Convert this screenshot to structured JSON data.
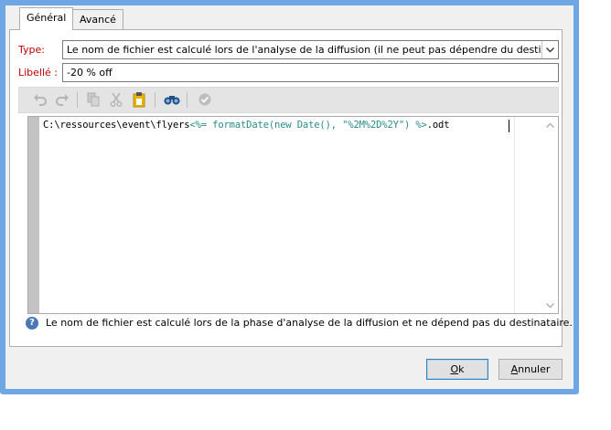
{
  "tabs": [
    {
      "label": "Général",
      "active": true
    },
    {
      "label": "Avancé",
      "active": false
    }
  ],
  "form": {
    "type_label": "Type:",
    "type_value": "Le nom de fichier est calculé lors de l'analyse de la diffusion (il ne peut pas dépendre du destinataire)",
    "libelle_label": "Libellé :",
    "libelle_value": "-20 % off"
  },
  "toolbar": {
    "icons": [
      "undo-icon",
      "redo-icon",
      "copy-icon",
      "cut-icon",
      "paste-icon",
      "find-icon",
      "validate-icon"
    ]
  },
  "editor": {
    "code_plain": "C:\\ressources\\event\\flyers",
    "code_tag": "<%= formatDate(new Date(), \"%2M%2D%2Y\") %>",
    "code_suffix": ".odt"
  },
  "info": {
    "icon": "question-icon",
    "text": "Le nom de fichier est calculé lors de la phase d'analyse de la diffusion et ne dépend pas du destinataire."
  },
  "buttons": {
    "ok_first": "O",
    "ok_rest": "k",
    "cancel_first": "A",
    "cancel_rest": "nnuler"
  },
  "colors": {
    "frame": "#6ea7e3",
    "label_red": "#c00000",
    "code_tag": "#2a8a8a",
    "info_blue": "#4a78b5"
  }
}
